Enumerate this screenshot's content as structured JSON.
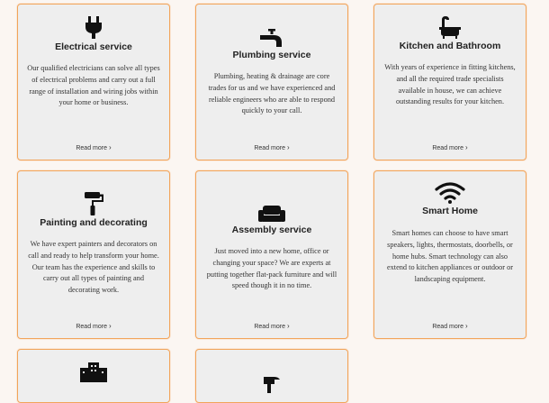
{
  "cards": [
    {
      "title": "Electrical service",
      "icon": "plug-icon",
      "desc": "Our qualified electricians can solve all types of electrical problems and carry out a full range of installation and wiring jobs within your home or business.",
      "more": "Read more"
    },
    {
      "title": "Plumbing service",
      "icon": "tap-icon",
      "desc": "Plumbing, heating & drainage are core trades for us and we have experienced and reliable engineers who are able to respond quickly to your call.",
      "more": "Read more"
    },
    {
      "title": "Kitchen and Bathroom",
      "icon": "bath-icon",
      "desc": "With years of experience in fitting kitchens, and all the required trade specialists available in house, we can achieve outstanding results for your kitchen.",
      "more": "Read more"
    },
    {
      "title": "Painting and decorating",
      "icon": "paint-roller-icon",
      "desc": "We have expert painters and decorators on call and ready to help transform your home. Our team has the experience and skills to carry out all types of painting and decorating work.",
      "more": "Read more"
    },
    {
      "title": "Assembly service",
      "icon": "sofa-icon",
      "desc": "Just moved into a new home, office or changing your space? We are experts at putting together flat-pack furniture and will speed though it in no time.",
      "more": "Read more"
    },
    {
      "title": "Smart Home",
      "icon": "wifi-icon",
      "desc": "Smart homes can choose to have smart speakers, lights, thermostats, doorbells, or home hubs. Smart technology can also extend to kitchen appliances or outdoor or landscaping equipment.",
      "more": "Read more"
    },
    {
      "icon": "building-icon"
    },
    {
      "icon": "tool-icon"
    }
  ]
}
